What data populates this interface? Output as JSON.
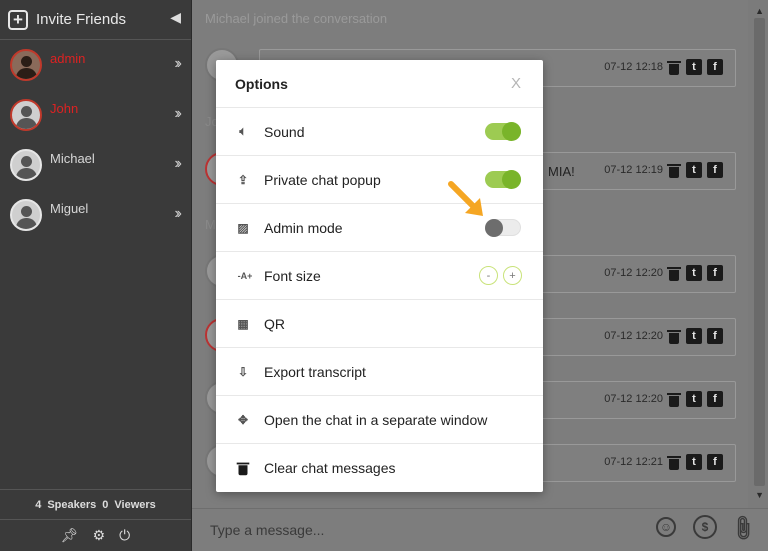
{
  "sidebar": {
    "invite_label": "Invite Friends",
    "users": [
      {
        "name": "admin",
        "status": "red"
      },
      {
        "name": "John",
        "status": "red"
      },
      {
        "name": "Michael",
        "status": "normal"
      },
      {
        "name": "Miguel",
        "status": "normal"
      }
    ],
    "stats": {
      "speakers_count": "4",
      "speakers_label": "Speakers",
      "viewers_count": "0",
      "viewers_label": "Viewers"
    }
  },
  "chat": {
    "system_message": "Michael joined the conversation",
    "letters": [
      "Jo",
      "M"
    ],
    "messages": [
      {
        "time": "07-12 12:18",
        "text": ""
      },
      {
        "time": "07-12 12:19",
        "text": "MIA!"
      },
      {
        "time": "07-12 12:20",
        "text": ""
      },
      {
        "time": "07-12 12:20",
        "text": ""
      },
      {
        "time": "07-12 12:20",
        "text": ""
      },
      {
        "time": "07-12 12:21",
        "text": ""
      }
    ],
    "composer_placeholder": "Type a message..."
  },
  "modal": {
    "title": "Options",
    "close_label": "X",
    "options": [
      {
        "icon": "speaker-icon",
        "label": "Sound",
        "control": "toggle-on"
      },
      {
        "icon": "popup-icon",
        "label": "Private chat popup",
        "control": "toggle-on"
      },
      {
        "icon": "admin-mode-icon",
        "label": "Admin mode",
        "control": "toggle-off"
      },
      {
        "icon": "font-size-icon",
        "label": "Font size",
        "control": "stepper"
      },
      {
        "icon": "qr-icon",
        "label": "QR",
        "control": "none"
      },
      {
        "icon": "export-icon",
        "label": "Export transcript",
        "control": "none"
      },
      {
        "icon": "move-icon",
        "label": "Open the chat in a separate window",
        "control": "none"
      },
      {
        "icon": "trash-icon",
        "label": "Clear chat messages",
        "control": "none"
      }
    ],
    "font_size_minus": "-",
    "font_size_plus": "+",
    "font_size_icon_text": "-A+"
  },
  "colors": {
    "toggle_on": "#79b42a",
    "toggle_off_knob": "#6d6d6d",
    "highlight_arrow": "#f5a623",
    "sidebar_bg": "#3a3a3a"
  }
}
